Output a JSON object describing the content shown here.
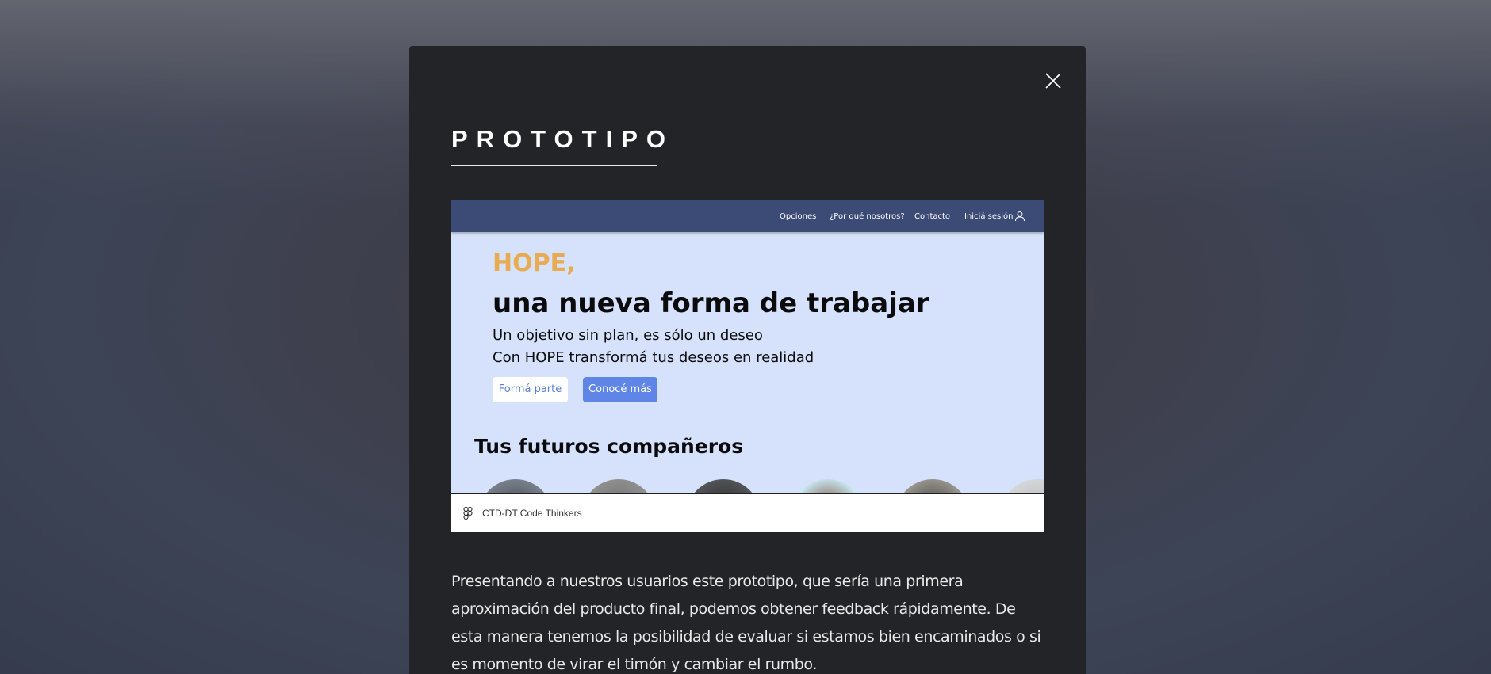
{
  "modal": {
    "title": "PROTOTIPO",
    "close_icon": "close-icon",
    "description": "Presentando a nuestros usuarios este prototipo, que sería una primera aproximación del producto final, podemos obtener feedback rápidamente. De esta manera tenemos la posibilidad de evaluar si estamos bien encaminados o si es momento de virar el timón y cambiar el rumbo."
  },
  "prototype": {
    "nav": {
      "items": [
        "Opciones",
        "¿Por qué nosotros?",
        "Contacto",
        "Iniciá sesión"
      ],
      "user_icon": "user-icon"
    },
    "hero": {
      "brand": "HOPE,",
      "headline": "una nueva forma de trabajar",
      "line1": "Un objetivo sin plan, es sólo un deseo",
      "line2": "Con HOPE transformá tus deseos en realidad",
      "primary_button": "Formá parte",
      "secondary_button": "Conocé más"
    },
    "team_heading": "Tus futuros compañeros",
    "footer": {
      "figma_icon": "figma-icon",
      "label": "CTD-DT Code Thinkers"
    }
  },
  "colors": {
    "modal_bg": "#232428",
    "nav_bg": "#3c4a76",
    "hero_bg": "#d6e2fb",
    "brand": "#e8ab52",
    "button_primary": "#5f86e6"
  }
}
